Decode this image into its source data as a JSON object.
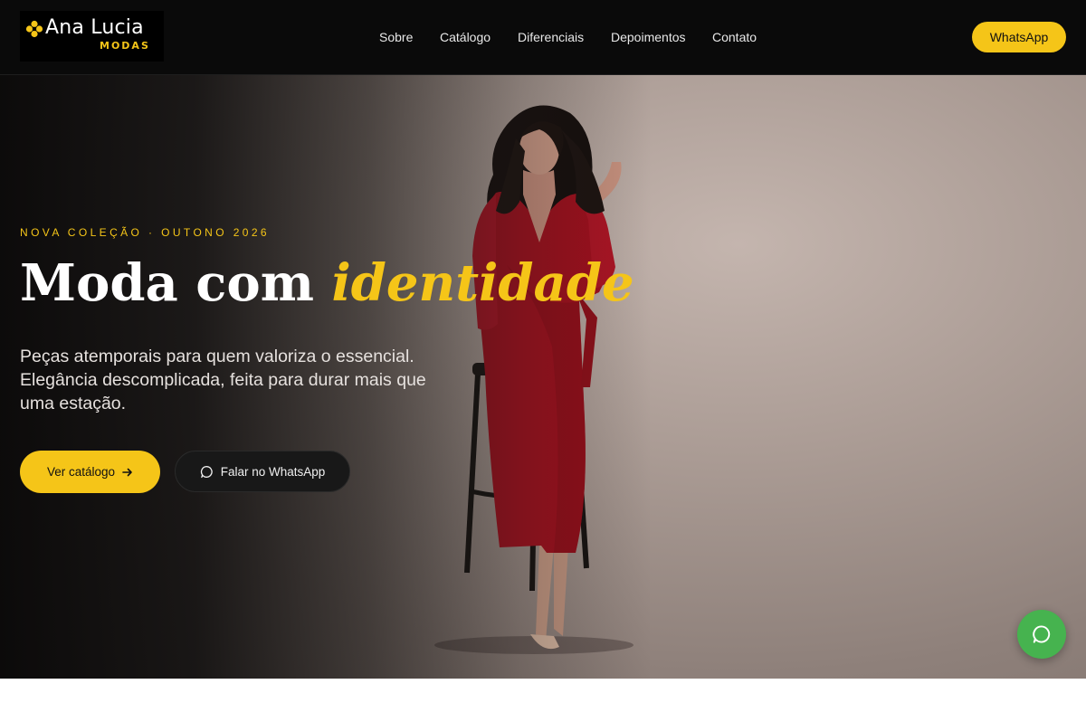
{
  "brand": {
    "name": "Ana Lucia",
    "subtitle": "Modas",
    "accent_color": "#f5c518"
  },
  "nav": {
    "items": [
      "Sobre",
      "Catálogo",
      "Diferenciais",
      "Depoimentos",
      "Contato"
    ],
    "cta_label": "WhatsApp"
  },
  "hero": {
    "eyebrow": "NOVA COLEÇÃO · OUTONO 2026",
    "headline_main": "Moda com",
    "headline_accent": "identidade",
    "lede": "Peças atemporais para quem valoriza o essencial. Elegância descomplicada, feita para durar mais que uma estação.",
    "primary_button": "Ver catálogo",
    "primary_button_icon": "arrow-right-icon",
    "secondary_button": "Falar no WhatsApp",
    "secondary_button_icon": "chat-bubble-icon"
  },
  "floating_button": {
    "icon": "chat-bubble-icon",
    "color": "#46b34f"
  }
}
